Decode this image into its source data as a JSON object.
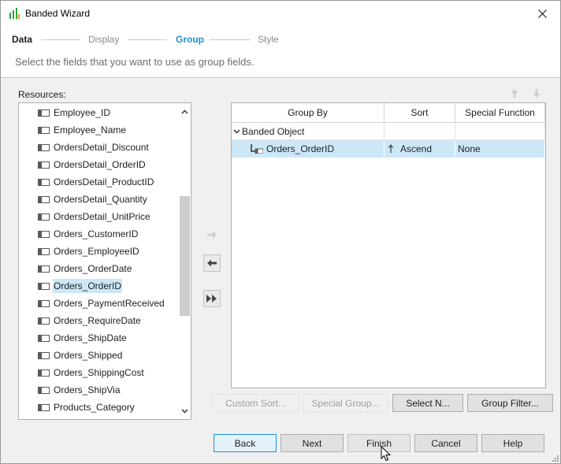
{
  "window": {
    "title": "Banded Wizard"
  },
  "steps": [
    {
      "label": "Data",
      "state": "done"
    },
    {
      "label": "Display",
      "state": "future"
    },
    {
      "label": "Group",
      "state": "current"
    },
    {
      "label": "Style",
      "state": "future"
    }
  ],
  "instruction": "Select the fields that you want to use as group fields.",
  "resources": {
    "label": "Resources:",
    "items": [
      "Employee_ID",
      "Employee_Name",
      "OrdersDetail_Discount",
      "OrdersDetail_OrderID",
      "OrdersDetail_ProductID",
      "OrdersDetail_Quantity",
      "OrdersDetail_UnitPrice",
      "Orders_CustomerID",
      "Orders_EmployeeID",
      "Orders_OrderDate",
      "Orders_OrderID",
      "Orders_PaymentReceived",
      "Orders_RequireDate",
      "Orders_ShipDate",
      "Orders_Shipped",
      "Orders_ShippingCost",
      "Orders_ShipVia",
      "Products_Category"
    ],
    "selected": "Orders_OrderID"
  },
  "group_table": {
    "columns": [
      "Group By",
      "Sort",
      "Special Function"
    ],
    "rows": [
      {
        "group_by": "Banded Object",
        "sort": "",
        "special": ""
      },
      {
        "group_by": "Orders_OrderID",
        "sort": "Ascend",
        "special": "None"
      }
    ]
  },
  "table_buttons": {
    "custom_sort": "Custom Sort...",
    "special_group": "Special Group...",
    "select_n": "Select N...",
    "group_filter": "Group Filter..."
  },
  "footer": {
    "back": "Back",
    "next": "Next",
    "finish": "Finish",
    "cancel": "Cancel",
    "help": "Help"
  },
  "colors": {
    "accent": "#1f8ed3",
    "selection": "#cce8f7"
  }
}
